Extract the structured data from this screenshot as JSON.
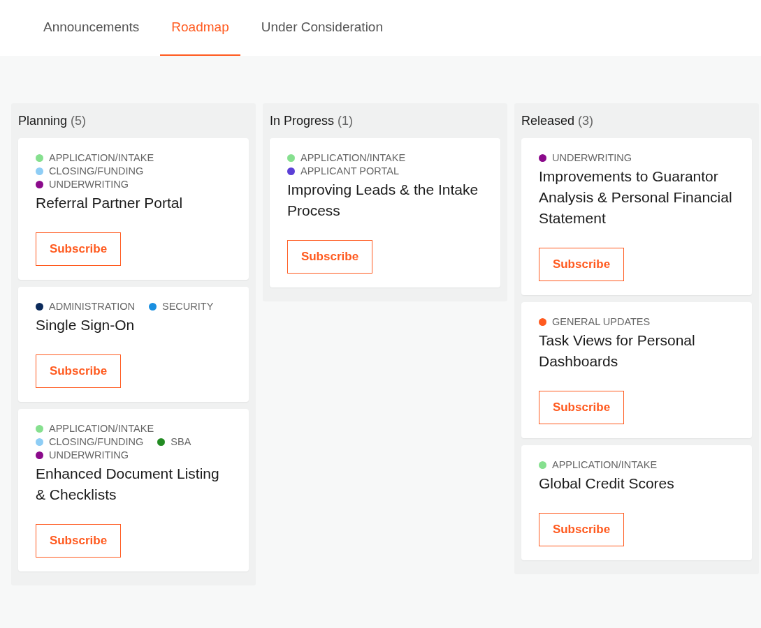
{
  "tabs": [
    {
      "label": "Announcements",
      "selected": false
    },
    {
      "label": "Roadmap",
      "selected": true
    },
    {
      "label": "Under Consideration",
      "selected": false
    }
  ],
  "columns": [
    {
      "title": "Planning",
      "count": "(5)",
      "cards": [
        {
          "tags": [
            {
              "label": "APPLICATION/INTAKE",
              "color": "#86e08f"
            },
            {
              "label": "CLOSING/FUNDING",
              "color": "#8ecdf5"
            },
            {
              "label": "UNDERWRITING",
              "color": "#8b0a8b"
            }
          ],
          "title": "Referral Partner Portal",
          "button": "Subscribe"
        },
        {
          "tags": [
            {
              "label": "ADMINISTRATION",
              "color": "#0b2a5b"
            },
            {
              "label": "SECURITY",
              "color": "#1a8fe0"
            }
          ],
          "title": "Single Sign-On",
          "button": "Subscribe"
        },
        {
          "tags": [
            {
              "label": "APPLICATION/INTAKE",
              "color": "#86e08f"
            },
            {
              "label": "CLOSING/FUNDING",
              "color": "#8ecdf5"
            },
            {
              "label": "SBA",
              "color": "#228b22"
            },
            {
              "label": "UNDERWRITING",
              "color": "#8b0a8b"
            }
          ],
          "title": "Enhanced Document Listing & Checklists",
          "button": "Subscribe"
        }
      ]
    },
    {
      "title": "In Progress",
      "count": "(1)",
      "cards": [
        {
          "tags": [
            {
              "label": "APPLICATION/INTAKE",
              "color": "#86e08f"
            },
            {
              "label": "APPLICANT PORTAL",
              "color": "#5b3fd6"
            }
          ],
          "title": "Improving Leads & the Intake Process",
          "button": "Subscribe"
        }
      ]
    },
    {
      "title": "Released",
      "count": "(3)",
      "cards": [
        {
          "tags": [
            {
              "label": "UNDERWRITING",
              "color": "#8b0a8b"
            }
          ],
          "title": "Improvements to Guarantor Analysis & Personal Financial Statement",
          "button": "Subscribe"
        },
        {
          "tags": [
            {
              "label": "GENERAL UPDATES",
              "color": "#ff5a1f"
            }
          ],
          "title": "Task Views for Personal Dashboards",
          "button": "Subscribe"
        },
        {
          "tags": [
            {
              "label": "APPLICATION/INTAKE",
              "color": "#86e08f"
            }
          ],
          "title": "Global Credit Scores",
          "button": "Subscribe"
        }
      ]
    }
  ]
}
